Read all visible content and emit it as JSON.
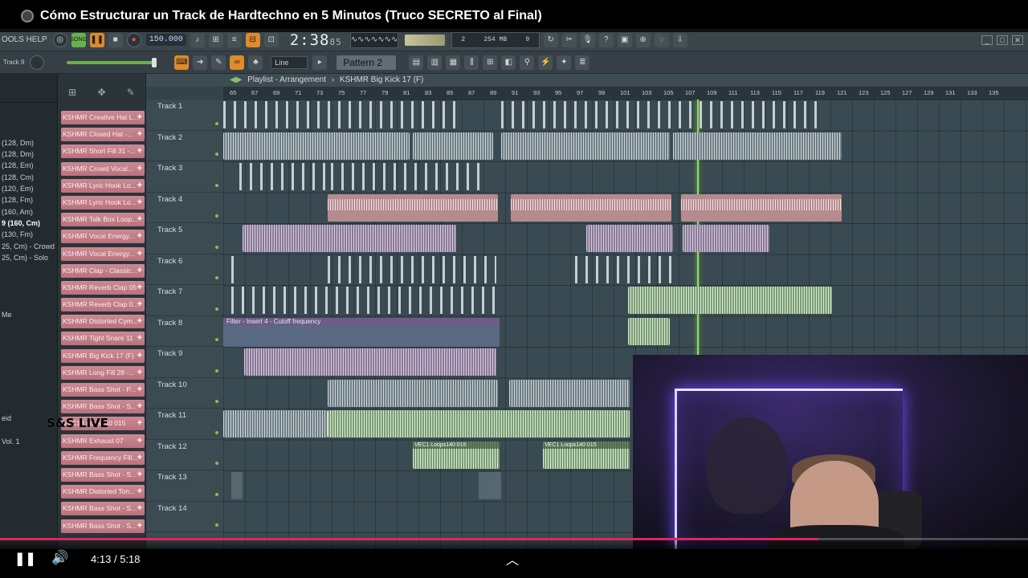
{
  "video": {
    "title": "Cómo Estructurar un Track de Hardtechno en 5 Minutos (Truco SECRETO al Final)",
    "current_time": "4:13",
    "separator": "/",
    "duration": "5:18",
    "progress": 0.796
  },
  "toolbar": {
    "menu": "OOLS  HELP",
    "tempo": "150.000",
    "time": "2:38",
    "time_frac": "85",
    "cpu_left": "2",
    "cpu_mem": "254 MB",
    "cpu_poly": "9",
    "line_select": "Line",
    "pattern": "Pattern 2",
    "track_hint": "Track 9"
  },
  "playlist": {
    "breadcrumb": "Playlist - Arrangement",
    "sep": "›",
    "channel": "KSHMR Big Kick 17 (F)",
    "ruler": [
      "65",
      "67",
      "69",
      "71",
      "73",
      "75",
      "77",
      "79",
      "81",
      "83",
      "85",
      "87",
      "89",
      "91",
      "93",
      "95",
      "97",
      "99",
      "101",
      "103",
      "105",
      "107",
      "109",
      "111",
      "113",
      "115",
      "117",
      "119",
      "121",
      "123",
      "125",
      "127",
      "129",
      "131",
      "133",
      "135"
    ],
    "tracks": [
      "Track 1",
      "Track 2",
      "Track 3",
      "Track 4",
      "Track 5",
      "Track 6",
      "Track 7",
      "Track 8",
      "Track 9",
      "Track 10",
      "Track 11",
      "Track 12",
      "Track 13",
      "Track 14"
    ],
    "automation_label": "Filter - Insert 4 - Cutoff frequency",
    "clip_label_12": "VEC1 Loops140 015"
  },
  "browser": {
    "items": [
      "",
      "",
      "",
      "(128, Dm)",
      "(128, Dm)",
      "(128, Em)",
      "(128, Cm)",
      "(120, Em)",
      "(128, Fm)",
      "(160, Am)",
      "9 (160, Cm)",
      "(130, Fm)",
      "25, Cm) - Crowd",
      "25, Cm) - Solo",
      "",
      "",
      "",
      "",
      "Me",
      "",
      "",
      "",
      "",
      "",
      "",
      "",
      "",
      "eid",
      "",
      "Vol. 1"
    ]
  },
  "channels": [
    "KSHMR Creative Hat L...",
    "KSHMR Closed Hat -...",
    "KSHMR Short Fill 31 -...",
    "KSHMR Crowd Vocal...",
    "KSHMR Lyric Hook Lo...",
    "KSHMR Lyric Hook Lo...",
    "KSHMR Talk Box Loop...",
    "KSHMR Vocal Energy...",
    "KSHMR Vocal Energy...",
    "KSHMR Clap - Classic...",
    "KSHMR Reverb Clap 05",
    "KSHMR Reverb Clap 0...",
    "KSHMR Distorted Cym...",
    "KSHMR Tight Snare 11",
    "KSHMR Big Kick 17 (F)",
    "KSHMR Long Fill 28 -...",
    "KSHMR Bass Shot - P...",
    "KSHMR Bass Shot - S...",
    "VEC1 Loops140 015",
    "KSHMR Exhaust 07",
    "KSHMR Frequency Fill...",
    "KSHMR Bass Shot - S...",
    "KSHMR Distorted Ton...",
    "KSHMR Bass Shot - S...",
    "KSHMR Bass Shot - S..."
  ],
  "overlay": {
    "live_text": "S&S LIVE"
  },
  "colors": {
    "progress": "#e0245e",
    "playhead": "#8ee05a",
    "channel": "#c27f89",
    "neon": "#6f4bff"
  }
}
